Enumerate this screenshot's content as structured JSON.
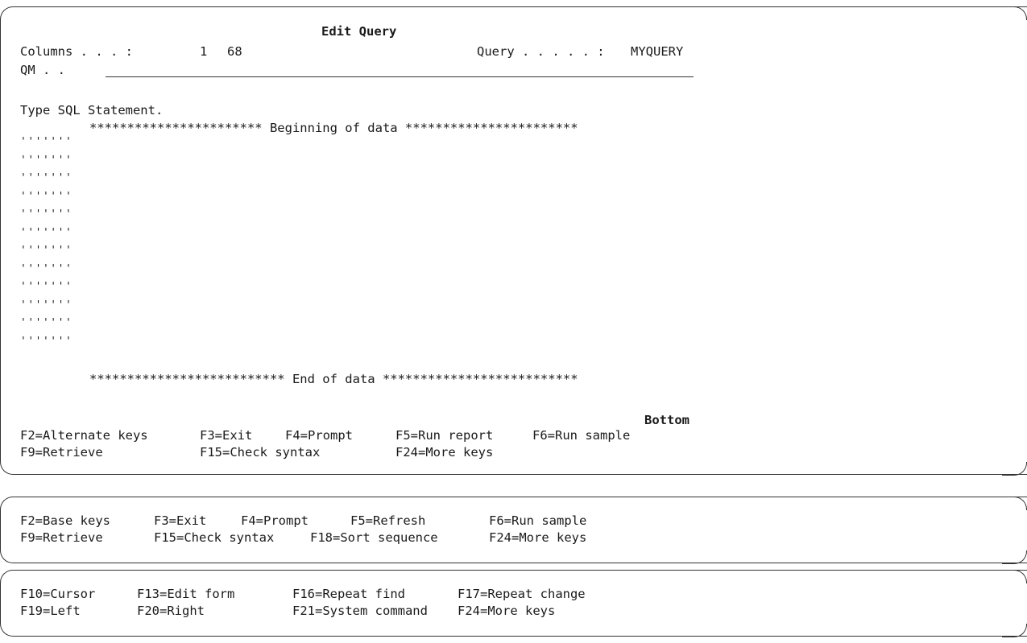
{
  "header": {
    "title": "Edit Query",
    "columns_label": "Columns . . . :",
    "columns_start": "1",
    "columns_end": "68",
    "query_label": "Query . . . . . :",
    "query_value": "MYQUERY",
    "qm_label": "QM . .",
    "qm_value": ""
  },
  "body": {
    "instruction": "Type SQL Statement.",
    "beginning_marker": "*********************** Beginning of data ***********************",
    "line_prefix": "'''''''",
    "line_count": 12,
    "end_marker": "************************** End of data **************************",
    "position_indicator": "Bottom"
  },
  "function_keys": {
    "row1": [
      "F2=Alternate keys",
      "F3=Exit",
      "F4=Prompt",
      "F5=Run report",
      "F6=Run sample"
    ],
    "row2": [
      "F9=Retrieve",
      "F15=Check syntax",
      "F24=More keys"
    ]
  },
  "alternate_keys_1": {
    "row1": [
      "F2=Base keys",
      "F3=Exit",
      "F4=Prompt",
      "F5=Refresh",
      "F6=Run sample"
    ],
    "row2": [
      "F9=Retrieve",
      "F15=Check syntax",
      "F18=Sort sequence",
      "F24=More keys"
    ]
  },
  "alternate_keys_2": {
    "row1": [
      "F10=Cursor",
      "F13=Edit form",
      "F16=Repeat find",
      "F17=Repeat change"
    ],
    "row2": [
      "F19=Left",
      "F20=Right",
      "F21=System command",
      "F24=More keys"
    ]
  }
}
